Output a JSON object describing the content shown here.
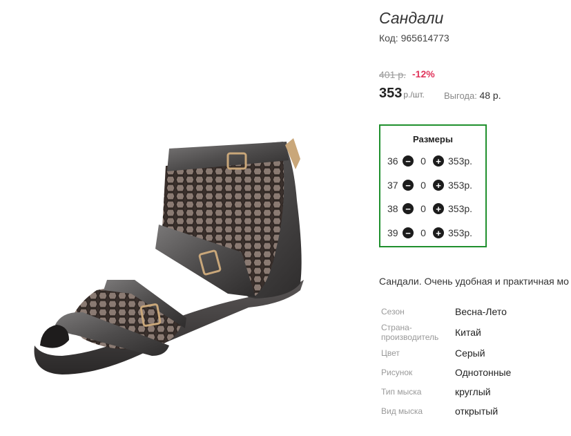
{
  "product": {
    "title": "Сандали",
    "sku": "Код: 965614773",
    "old_price": "401 р.",
    "discount": "-12%",
    "price": "353",
    "unit": "р./шт.",
    "benefit_label": "Выгода:",
    "benefit_value": "48 р."
  },
  "sizes": {
    "title": "Размеры",
    "rows": [
      {
        "size": "36",
        "qty": "0",
        "price": "353р."
      },
      {
        "size": "37",
        "qty": "0",
        "price": "353р."
      },
      {
        "size": "38",
        "qty": "0",
        "price": "353р."
      },
      {
        "size": "39",
        "qty": "0",
        "price": "353р."
      }
    ],
    "minus_icon": "minus-circle-icon",
    "plus_icon": "plus-circle-icon"
  },
  "description": "Сандали. Очень удобная и практичная мо",
  "properties": [
    {
      "label": "Сезон",
      "value": "Весна-Лето"
    },
    {
      "label": "Страна-производитель",
      "value": "Китай"
    },
    {
      "label": "Цвет",
      "value": "Серый"
    },
    {
      "label": "Рисунок",
      "value": "Однотонные"
    },
    {
      "label": "Тип мыска",
      "value": "круглый"
    },
    {
      "label": "Вид мыска",
      "value": "открытый"
    }
  ],
  "colors": {
    "sizes_border": "#1e8f2c",
    "discount": "#e0335a"
  }
}
